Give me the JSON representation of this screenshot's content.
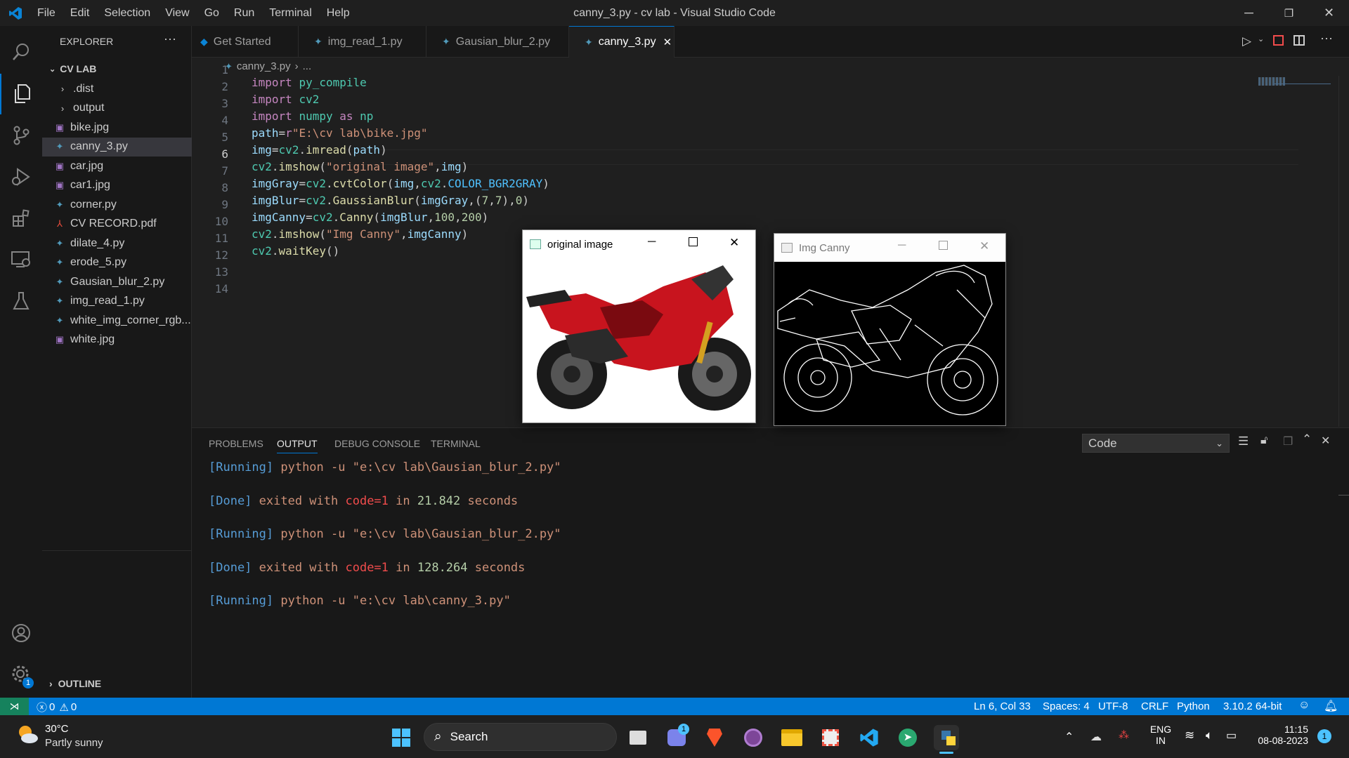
{
  "window": {
    "title": "canny_3.py - cv lab - Visual Studio Code"
  },
  "menu": [
    "File",
    "Edit",
    "Selection",
    "View",
    "Go",
    "Run",
    "Terminal",
    "Help"
  ],
  "explorer": {
    "header": "EXPLORER",
    "folder": "CV LAB",
    "items": [
      {
        "label": ".dist",
        "type": "folder"
      },
      {
        "label": "output",
        "type": "folder"
      },
      {
        "label": "bike.jpg",
        "type": "image"
      },
      {
        "label": "canny_3.py",
        "type": "python",
        "selected": true
      },
      {
        "label": "car.jpg",
        "type": "image"
      },
      {
        "label": "car1.jpg",
        "type": "image"
      },
      {
        "label": "corner.py",
        "type": "python"
      },
      {
        "label": "CV RECORD.pdf",
        "type": "pdf"
      },
      {
        "label": "dilate_4.py",
        "type": "python"
      },
      {
        "label": "erode_5.py",
        "type": "python"
      },
      {
        "label": "Gausian_blur_2.py",
        "type": "python"
      },
      {
        "label": "img_read_1.py",
        "type": "python"
      },
      {
        "label": "white_img_corner_rgb...",
        "type": "python"
      },
      {
        "label": "white.jpg",
        "type": "image"
      }
    ],
    "outline": "OUTLINE"
  },
  "tabs": [
    {
      "label": "Get Started",
      "active": false
    },
    {
      "label": "img_read_1.py",
      "active": false
    },
    {
      "label": "Gausian_blur_2.py",
      "active": false
    },
    {
      "label": "canny_3.py",
      "active": true
    }
  ],
  "breadcrumb": {
    "file": "canny_3.py",
    "rest": "..."
  },
  "code": {
    "line_numbers": [
      "1",
      "2",
      "3",
      "4",
      "5",
      "6",
      "7",
      "8",
      "9",
      "10",
      "11",
      "12",
      "13",
      "14"
    ],
    "current_line": "6"
  },
  "panel": {
    "tabs": [
      "PROBLEMS",
      "OUTPUT",
      "DEBUG CONSOLE",
      "TERMINAL"
    ],
    "active_tab": "OUTPUT",
    "channel": "Code",
    "output": [
      {
        "tag": "[Running]",
        "text": " python -u \"e:\\cv lab\\Gausian_blur_2.py\""
      },
      {
        "tag": "[Done]",
        "text": " exited with ",
        "code": "code=1",
        "in": " in ",
        "time": "21.842",
        "sec": " seconds"
      },
      {
        "tag": "[Running]",
        "text": " python -u \"e:\\cv lab\\Gausian_blur_2.py\""
      },
      {
        "tag": "[Done]",
        "text": " exited with ",
        "code": "code=1",
        "in": " in ",
        "time": "128.264",
        "sec": " seconds"
      },
      {
        "tag": "[Running]",
        "text": " python -u \"e:\\cv lab\\canny_3.py\""
      }
    ]
  },
  "cv_windows": {
    "original": {
      "title": "original image"
    },
    "canny": {
      "title": "Img Canny"
    }
  },
  "status": {
    "errors": "0",
    "warnings": "0",
    "position": "Ln 6, Col 33",
    "spaces": "Spaces: 4",
    "encoding": "UTF-8",
    "eol": "CRLF",
    "language": "Python",
    "interpreter": "3.10.2 64-bit"
  },
  "taskbar": {
    "weather_temp": "30°C",
    "weather_desc": "Partly sunny",
    "search": "Search",
    "lang1": "ENG",
    "lang2": "IN",
    "time": "11:15",
    "date": "08-08-2023",
    "notif": "1",
    "teams_badge": "1"
  },
  "colors": {
    "accent": "#0078d4",
    "editor_bg": "#1f1f1f",
    "sidebar_bg": "#181818"
  }
}
